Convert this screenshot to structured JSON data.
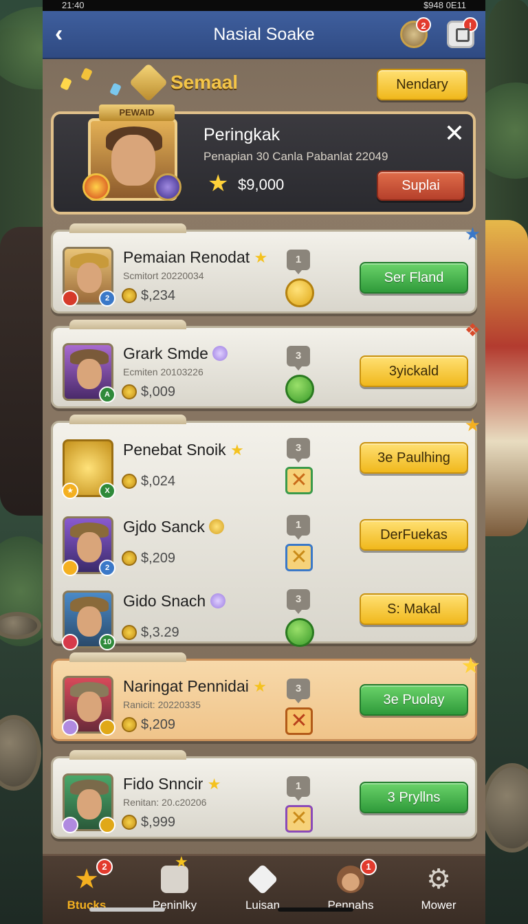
{
  "status_bar": {
    "time": "21:40",
    "right": "$948 0E11"
  },
  "topbar": {
    "back_icon": "chevron-left-icon",
    "title": "Nasial Soake",
    "compass_badge": "2"
  },
  "header": {
    "title": "Semaal",
    "action_label": "Nendary"
  },
  "feature": {
    "ribbon": "PEWAID",
    "title": "Peringkak",
    "subtitle": "Penapian 30 Canla Pabanlat 22049",
    "amount": "$9,000",
    "button_label": "Suplai"
  },
  "rows": [
    {
      "name": "Pemaian Renodat",
      "sub": "Scmitort 20220034",
      "amount": "$,234",
      "rank": "1",
      "button": "Ser Fland",
      "button_style": "green",
      "medal": "gold"
    },
    {
      "name": "Grark Smde",
      "sub": "Ecmiten 20103226",
      "amount": "$,009",
      "rank": "3",
      "button": "3yickald",
      "button_style": "yellow",
      "medal": "green"
    },
    {
      "name": "Penebat Snoik",
      "sub": "",
      "amount": "$,024",
      "rank": "3",
      "button": "3e Paulhing",
      "button_style": "yellow",
      "medal": "x-green"
    },
    {
      "name": "Gjdo Sanck",
      "sub": "",
      "amount": "$,209",
      "rank": "1",
      "button": "DerFuekas",
      "button_style": "yellow",
      "medal": "x-blue"
    },
    {
      "name": "Gido Snach",
      "sub": "",
      "amount": "$,3.29",
      "rank": "3",
      "button": "S: Makal",
      "button_style": "yellow",
      "medal": "green"
    },
    {
      "name": "Naringat Pennidai",
      "sub": "Ranicit: 20220335",
      "amount": "$,209",
      "rank": "3",
      "button": "3e Puolay",
      "button_style": "green",
      "medal": "x-orange"
    },
    {
      "name": "Fido Snncir",
      "sub": "Renitan: 20.c20206",
      "amount": "$,999",
      "rank": "1",
      "button": "3 Pryllns",
      "button_style": "green",
      "medal": "x-purple"
    }
  ],
  "bottom_nav": [
    {
      "label": "Btucks",
      "icon": "star-icon",
      "badge": "2",
      "active": true
    },
    {
      "label": "Peninlky",
      "icon": "puzzle-icon",
      "badge": "",
      "active": false
    },
    {
      "label": "Luisan",
      "icon": "diamond-icon",
      "badge": "",
      "active": false
    },
    {
      "label": "Pennahs",
      "icon": "avatar-icon",
      "badge": "1",
      "active": false
    },
    {
      "label": "Mower",
      "icon": "gear-icon",
      "badge": "",
      "active": false
    }
  ],
  "colors": {
    "topbar": "#3f5f9e",
    "accent_gold": "#f4c548",
    "button_green": "#2f9a3a",
    "button_yellow": "#f0b81c",
    "button_red": "#b5402b"
  }
}
